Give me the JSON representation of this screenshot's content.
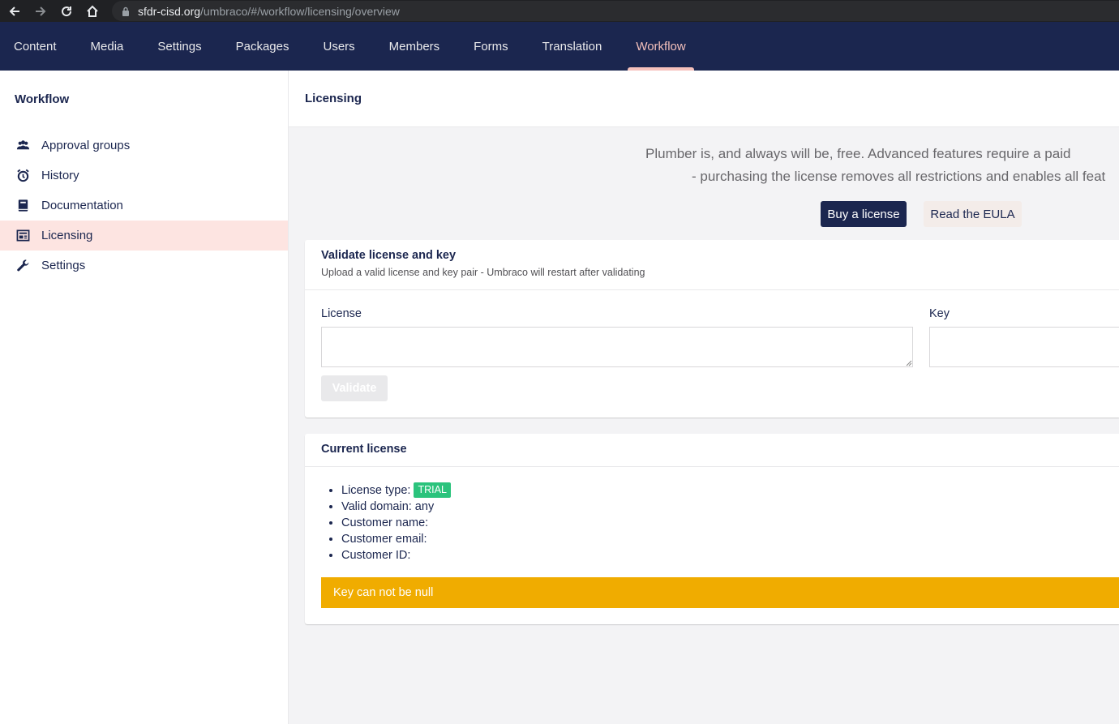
{
  "browser": {
    "url_domain": "sfdr-cisd.org",
    "url_path": "/umbraco/#/workflow/licensing/overview"
  },
  "topnav": {
    "items": [
      {
        "label": "Content"
      },
      {
        "label": "Media"
      },
      {
        "label": "Settings"
      },
      {
        "label": "Packages"
      },
      {
        "label": "Users"
      },
      {
        "label": "Members"
      },
      {
        "label": "Forms"
      },
      {
        "label": "Translation"
      },
      {
        "label": "Workflow",
        "active": true
      }
    ]
  },
  "sidebar": {
    "title": "Workflow",
    "items": [
      {
        "label": "Approval groups",
        "icon": "users-icon"
      },
      {
        "label": "History",
        "icon": "alarm-clock-icon"
      },
      {
        "label": "Documentation",
        "icon": "book-icon"
      },
      {
        "label": "Licensing",
        "icon": "license-icon",
        "active": true
      },
      {
        "label": "Settings",
        "icon": "wrench-icon"
      }
    ]
  },
  "main": {
    "title": "Licensing",
    "intro_line1": "Plumber is, and always will be, free. Advanced features require a paid",
    "intro_line2": "- purchasing the license removes all restrictions and enables all feat",
    "buy_label": "Buy a license",
    "eula_label": "Read the EULA",
    "validate_box": {
      "title": "Validate license and key",
      "description": "Upload a valid license and key pair - Umbraco will restart after validating",
      "license_label": "License",
      "key_label": "Key",
      "license_value": "",
      "key_value": "",
      "validate_label": "Validate"
    },
    "current_box": {
      "title": "Current license",
      "license_type_label": "License type:",
      "license_type_value": "TRIAL",
      "valid_domain": "Valid domain: any",
      "customer_name": "Customer name:",
      "customer_email": "Customer email:",
      "customer_id": "Customer ID:",
      "alert": "Key can not be null"
    }
  },
  "colors": {
    "nav_bg": "#1b264f",
    "accent": "#f5c1bc",
    "trial_badge": "#2bc37c",
    "warning": "#f0ac00"
  }
}
